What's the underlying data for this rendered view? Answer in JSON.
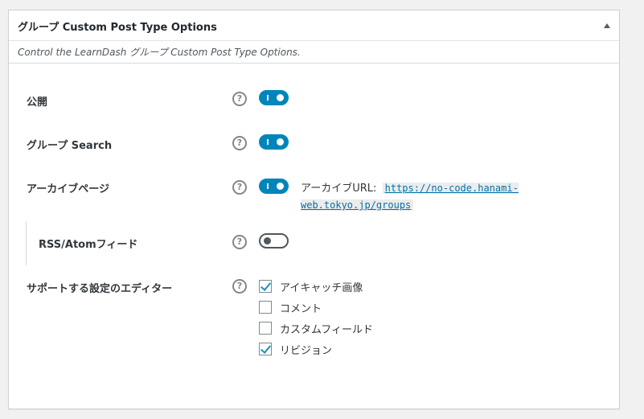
{
  "panel": {
    "title": "グループ Custom Post Type Options",
    "description": "Control the LearnDash グループ Custom Post Type Options."
  },
  "rows": {
    "public": {
      "label": "公開",
      "toggle_on": true
    },
    "search": {
      "label": "グループ Search",
      "toggle_on": true
    },
    "archive": {
      "label": "アーカイブページ",
      "toggle_on": true,
      "url_label": "アーカイブURL:",
      "url": "https://no-code.hanami-web.tokyo.jp/groups"
    },
    "rss": {
      "label": "RSS/Atomフィード",
      "toggle_on": false
    },
    "editor": {
      "label": "サポートする設定のエディター",
      "options": [
        {
          "label": "アイキャッチ画像",
          "checked": true
        },
        {
          "label": "コメント",
          "checked": false
        },
        {
          "label": "カスタムフィールド",
          "checked": false
        },
        {
          "label": "リビジョン",
          "checked": true
        }
      ]
    }
  },
  "help_glyph": "?",
  "accent_color": "#0085ba"
}
